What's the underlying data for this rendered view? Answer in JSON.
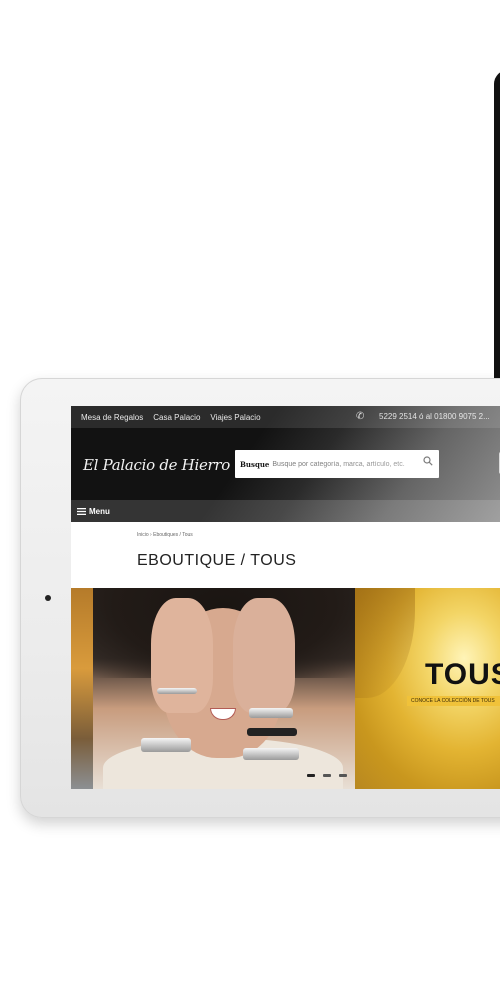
{
  "utility_bar": {
    "links": [
      "Mesa de Regalos",
      "Casa Palacio",
      "Viajes Palacio"
    ],
    "phone_text": "5229 2514  ó  al 01800 9075 2..."
  },
  "header": {
    "logo_text": "El Palacio de Hierro",
    "search": {
      "label": "Busque",
      "placeholder": "Busque por categoría, marca, artículo, etc."
    }
  },
  "menu_bar": {
    "label": "Menu"
  },
  "breadcrumb": "Inicio  ›  Eboutiques / Tous",
  "page_title": "EBOUTIQUE / TOUS",
  "hero": {
    "brand": "TOUS",
    "tagline": "CONOCE LA COLECCIÓN DE TOUS",
    "slides": 3,
    "active_slide": 1
  },
  "colors": {
    "header_bg": "#121212",
    "utility_bg": "#2b2b2b",
    "menu_bg": "#343434",
    "tous_gold": "#e3b432"
  }
}
